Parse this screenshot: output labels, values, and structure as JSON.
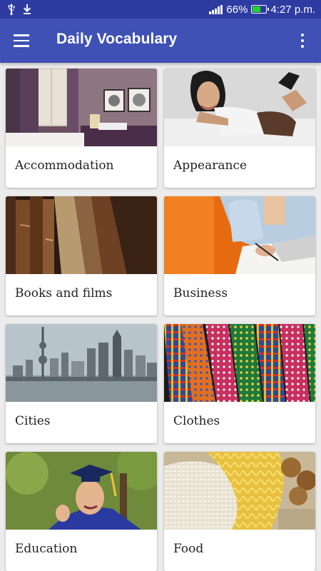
{
  "status_bar": {
    "battery_level": "66%",
    "battery_fraction": 0.66,
    "time": "4:27 p.m.",
    "left_icons": [
      "usb-icon",
      "download-icon"
    ],
    "right_icons": [
      "signal-icon",
      "battery-icon"
    ]
  },
  "app_bar": {
    "title": "Daily Vocabulary",
    "menu_icon": "hamburger-menu-icon",
    "overflow_icon": "more-vert-icon",
    "color": "#3f51b5",
    "status_color": "#2e3ba0"
  },
  "categories": [
    {
      "label": "Accommodation",
      "image": "hotel-room-photo"
    },
    {
      "label": "Appearance",
      "image": "woman-portrait-photo"
    },
    {
      "label": "Books and films",
      "image": "old-books-photo"
    },
    {
      "label": "Business",
      "image": "businessman-writing-photo"
    },
    {
      "label": "Cities",
      "image": "city-skyline-photo"
    },
    {
      "label": "Clothes",
      "image": "neckties-photo"
    },
    {
      "label": "Education",
      "image": "graduate-photo"
    },
    {
      "label": "Food",
      "image": "pasta-rice-photo"
    }
  ]
}
